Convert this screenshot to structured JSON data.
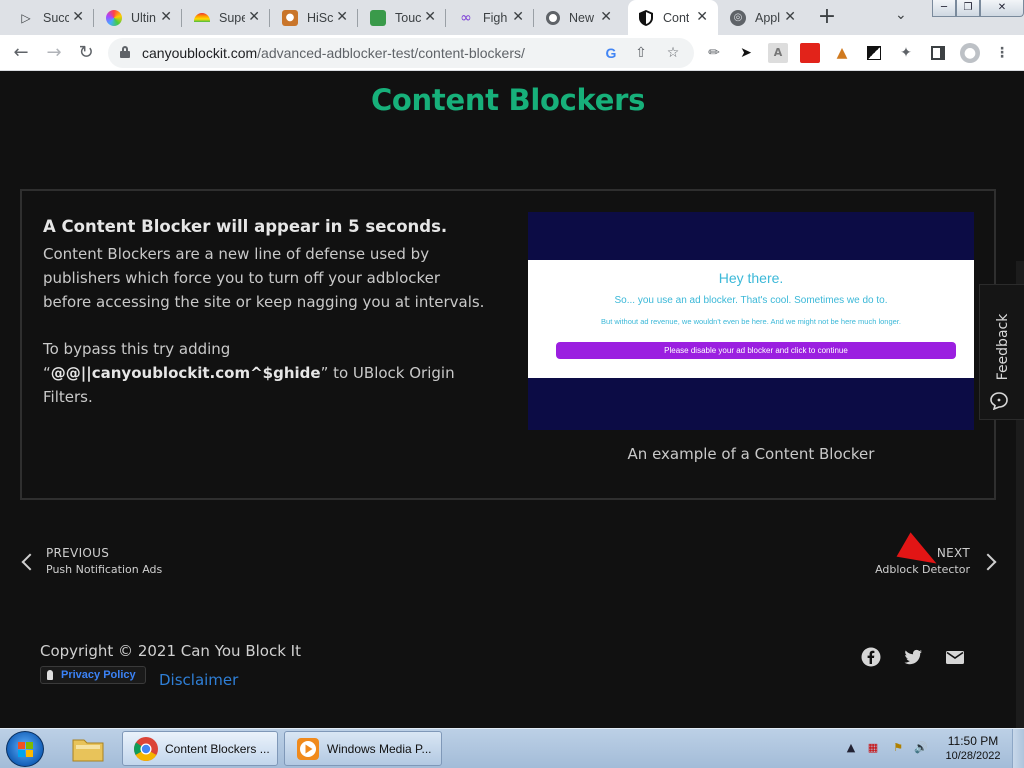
{
  "browser": {
    "tabs": [
      {
        "title": "Succ",
        "icon": "play-arrow-icon",
        "active": false
      },
      {
        "title": "Ultin",
        "icon": "color-wheel-icon",
        "active": false
      },
      {
        "title": "Supe",
        "icon": "rainbow-icon",
        "active": false
      },
      {
        "title": "HiSc",
        "icon": "cat-icon",
        "active": false
      },
      {
        "title": "Touc",
        "icon": "map-icon",
        "active": false
      },
      {
        "title": "Figh",
        "icon": "swirl-icon",
        "active": false
      },
      {
        "title": "New",
        "icon": "chrome-icon",
        "active": false
      },
      {
        "title": "Cont",
        "icon": "shield-icon",
        "active": true
      },
      {
        "title": "Appl",
        "icon": "globe-icon",
        "active": false
      }
    ],
    "new_tab_symbol": "+",
    "address": {
      "domain": "canyoublockit.com",
      "path": "/advanced-adblocker-test/content-blockers/"
    }
  },
  "page": {
    "title": "Content Blockers",
    "lead": "A Content Blocker will appear in 5 seconds.",
    "description": "Content Blockers are a new line of defense used by publishers which force you to turn off your adblocker before accessing the site or keep nagging you at intervals.",
    "bypass_prefix": "To bypass this try adding “",
    "bypass_filter": "@@||canyoublockit.com^$ghide",
    "bypass_suffix": "” to UBlock Origin Filters.",
    "example": {
      "heading": "Hey there.",
      "subheading": "So... you use an ad blocker. That's cool. Sometimes we do to.",
      "small": "But without ad revenue, we wouldn't even be here. And we might not be here much longer.",
      "button": "Please disable your ad blocker and click to continue"
    },
    "caption": "An example of a Content Blocker",
    "feedback_label": "Feedback",
    "prev": {
      "label": "PREVIOUS",
      "title": "Push Notification Ads"
    },
    "next": {
      "label": "NEXT",
      "title": "Adblock Detector"
    },
    "copyright": "Copyright © 2021 Can You Block It",
    "privacy_policy": "Privacy Policy",
    "disclaimer": "Disclaimer"
  },
  "taskbar": {
    "items": [
      {
        "label": "Content Blockers ...",
        "icon": "chrome-icon",
        "active": true
      },
      {
        "label": "Windows Media P...",
        "icon": "media-player-icon",
        "active": false
      }
    ],
    "clock": {
      "time": "11:50 PM",
      "date": "10/28/2022"
    }
  },
  "colors": {
    "accent": "#17b07a",
    "link": "#2f7fd6",
    "page_bg": "#111111",
    "example_button": "#9b1fe0"
  }
}
